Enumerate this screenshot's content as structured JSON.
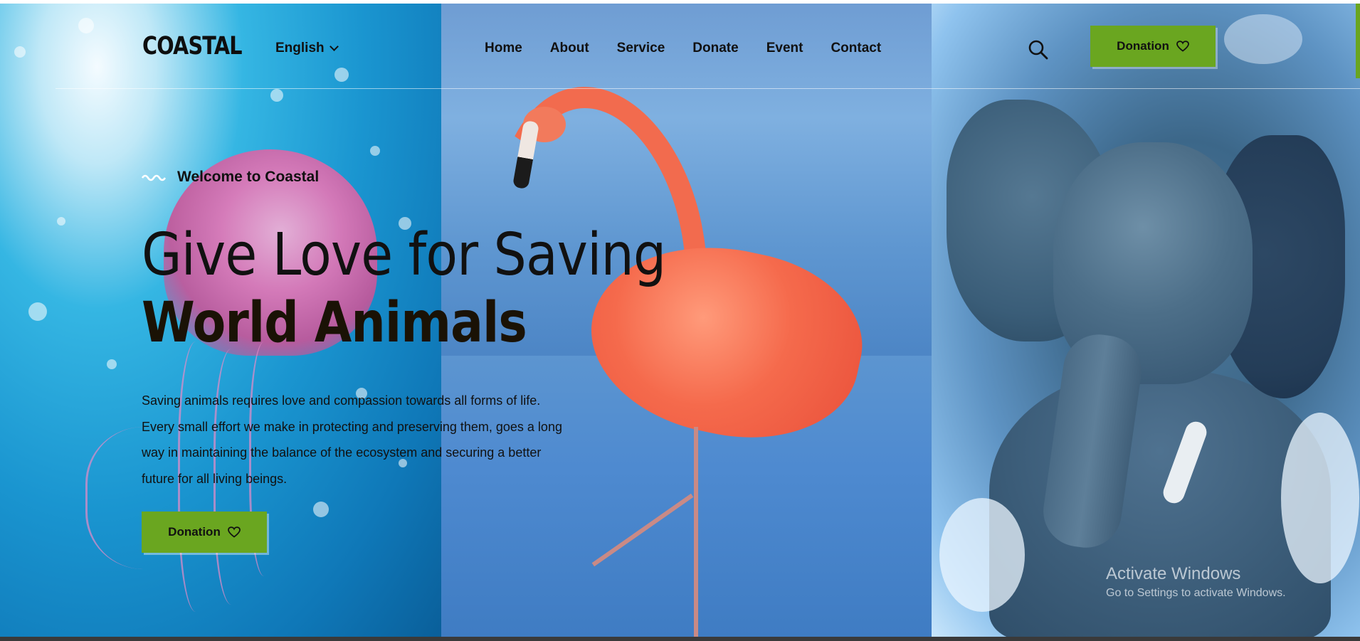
{
  "header": {
    "logo": "COASTAL",
    "language": "English",
    "nav": [
      "Home",
      "About",
      "Service",
      "Donate",
      "Event",
      "Contact"
    ],
    "donate_label": "Donation"
  },
  "hero": {
    "eyebrow": "Welcome to Coastal",
    "title_line1": "Give Love for Saving",
    "title_line2": "World Animals",
    "paragraph_lines": [
      "Saving animals requires love and compassion towards all forms of life.",
      "Every small effort we make in protecting and preserving them, goes a long",
      "way in maintaining the balance of the ecosystem and securing a better",
      "future for all living beings."
    ],
    "donate_label": "Donation"
  },
  "watermark": {
    "title": "Activate Windows",
    "subtitle": "Go to Settings to activate Windows."
  },
  "colors": {
    "accent_green": "#6aa620",
    "text_dark": "#111111"
  },
  "icons": {
    "search": "search-icon",
    "heart": "heart-icon",
    "wave": "wave-icon",
    "chevron": "chevron-down-icon"
  }
}
